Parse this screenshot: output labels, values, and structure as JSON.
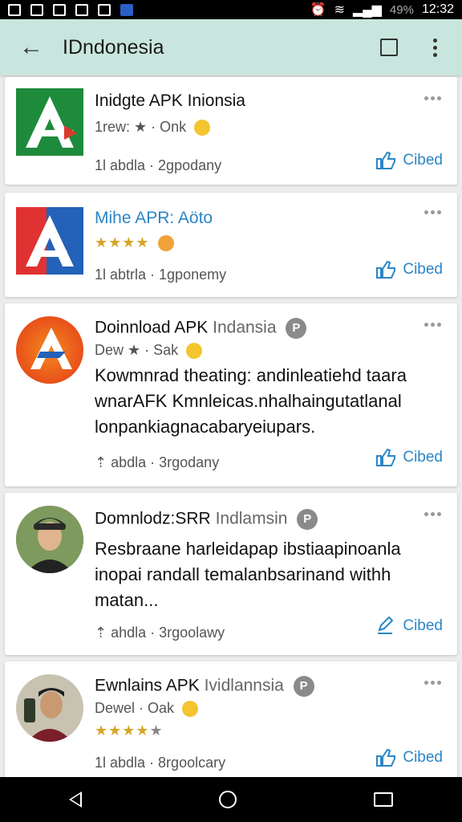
{
  "status_bar": {
    "battery": "49%",
    "time": "12:32"
  },
  "app_bar": {
    "title": "IDndonesia"
  },
  "cards": [
    {
      "name": "Inidgte APK Inionsia",
      "meta": "1rew: ★ · Onk",
      "size": "1l abdla · 2gpodany",
      "action": "Cibed"
    },
    {
      "name": "Mihe APR: Aöto",
      "stars": "★★★★",
      "size": "1l abtrla · 1gponemy",
      "action": "Cibed"
    },
    {
      "name": "Doinnload APK",
      "dev": "Indansia",
      "badge": "P",
      "meta": "Dew ★ · Sak",
      "desc_lines": [
        "Kowmnrad theating: andinleatiehd taara",
        "wnarAFK Kmnleicas.nhalhaingutatlanal",
        "lonpankiagnacabaryeiupars."
      ],
      "size": "abdla · 3rgodany",
      "action": "Cibed"
    },
    {
      "name": "Domnlodz:SRR",
      "dev": "Indlamsin",
      "badge": "P",
      "desc_lines": [
        "Resbraane harleidapap ibstiaapinoanla",
        "inopai randall temalanbsarinand withh",
        "matan..."
      ],
      "size": "ahdla · 3rgoolawy",
      "action": "Cibed"
    },
    {
      "name": "Ewnlains APK",
      "dev": "Ividlannsia",
      "badge": "P",
      "meta": "Dewel · Oak",
      "stars": "★★★★",
      "stars_off": "★",
      "size": "1l abdla · 8rgoolcary",
      "action": "Cibed"
    }
  ],
  "icons": {
    "back": "arrow-left-icon",
    "bookmark": "bookmark-icon",
    "more": "more-vert-icon",
    "action": "thumbs-up-icon"
  },
  "colors": {
    "app_bar": "#c9e6de",
    "accent": "#2b86c5"
  }
}
